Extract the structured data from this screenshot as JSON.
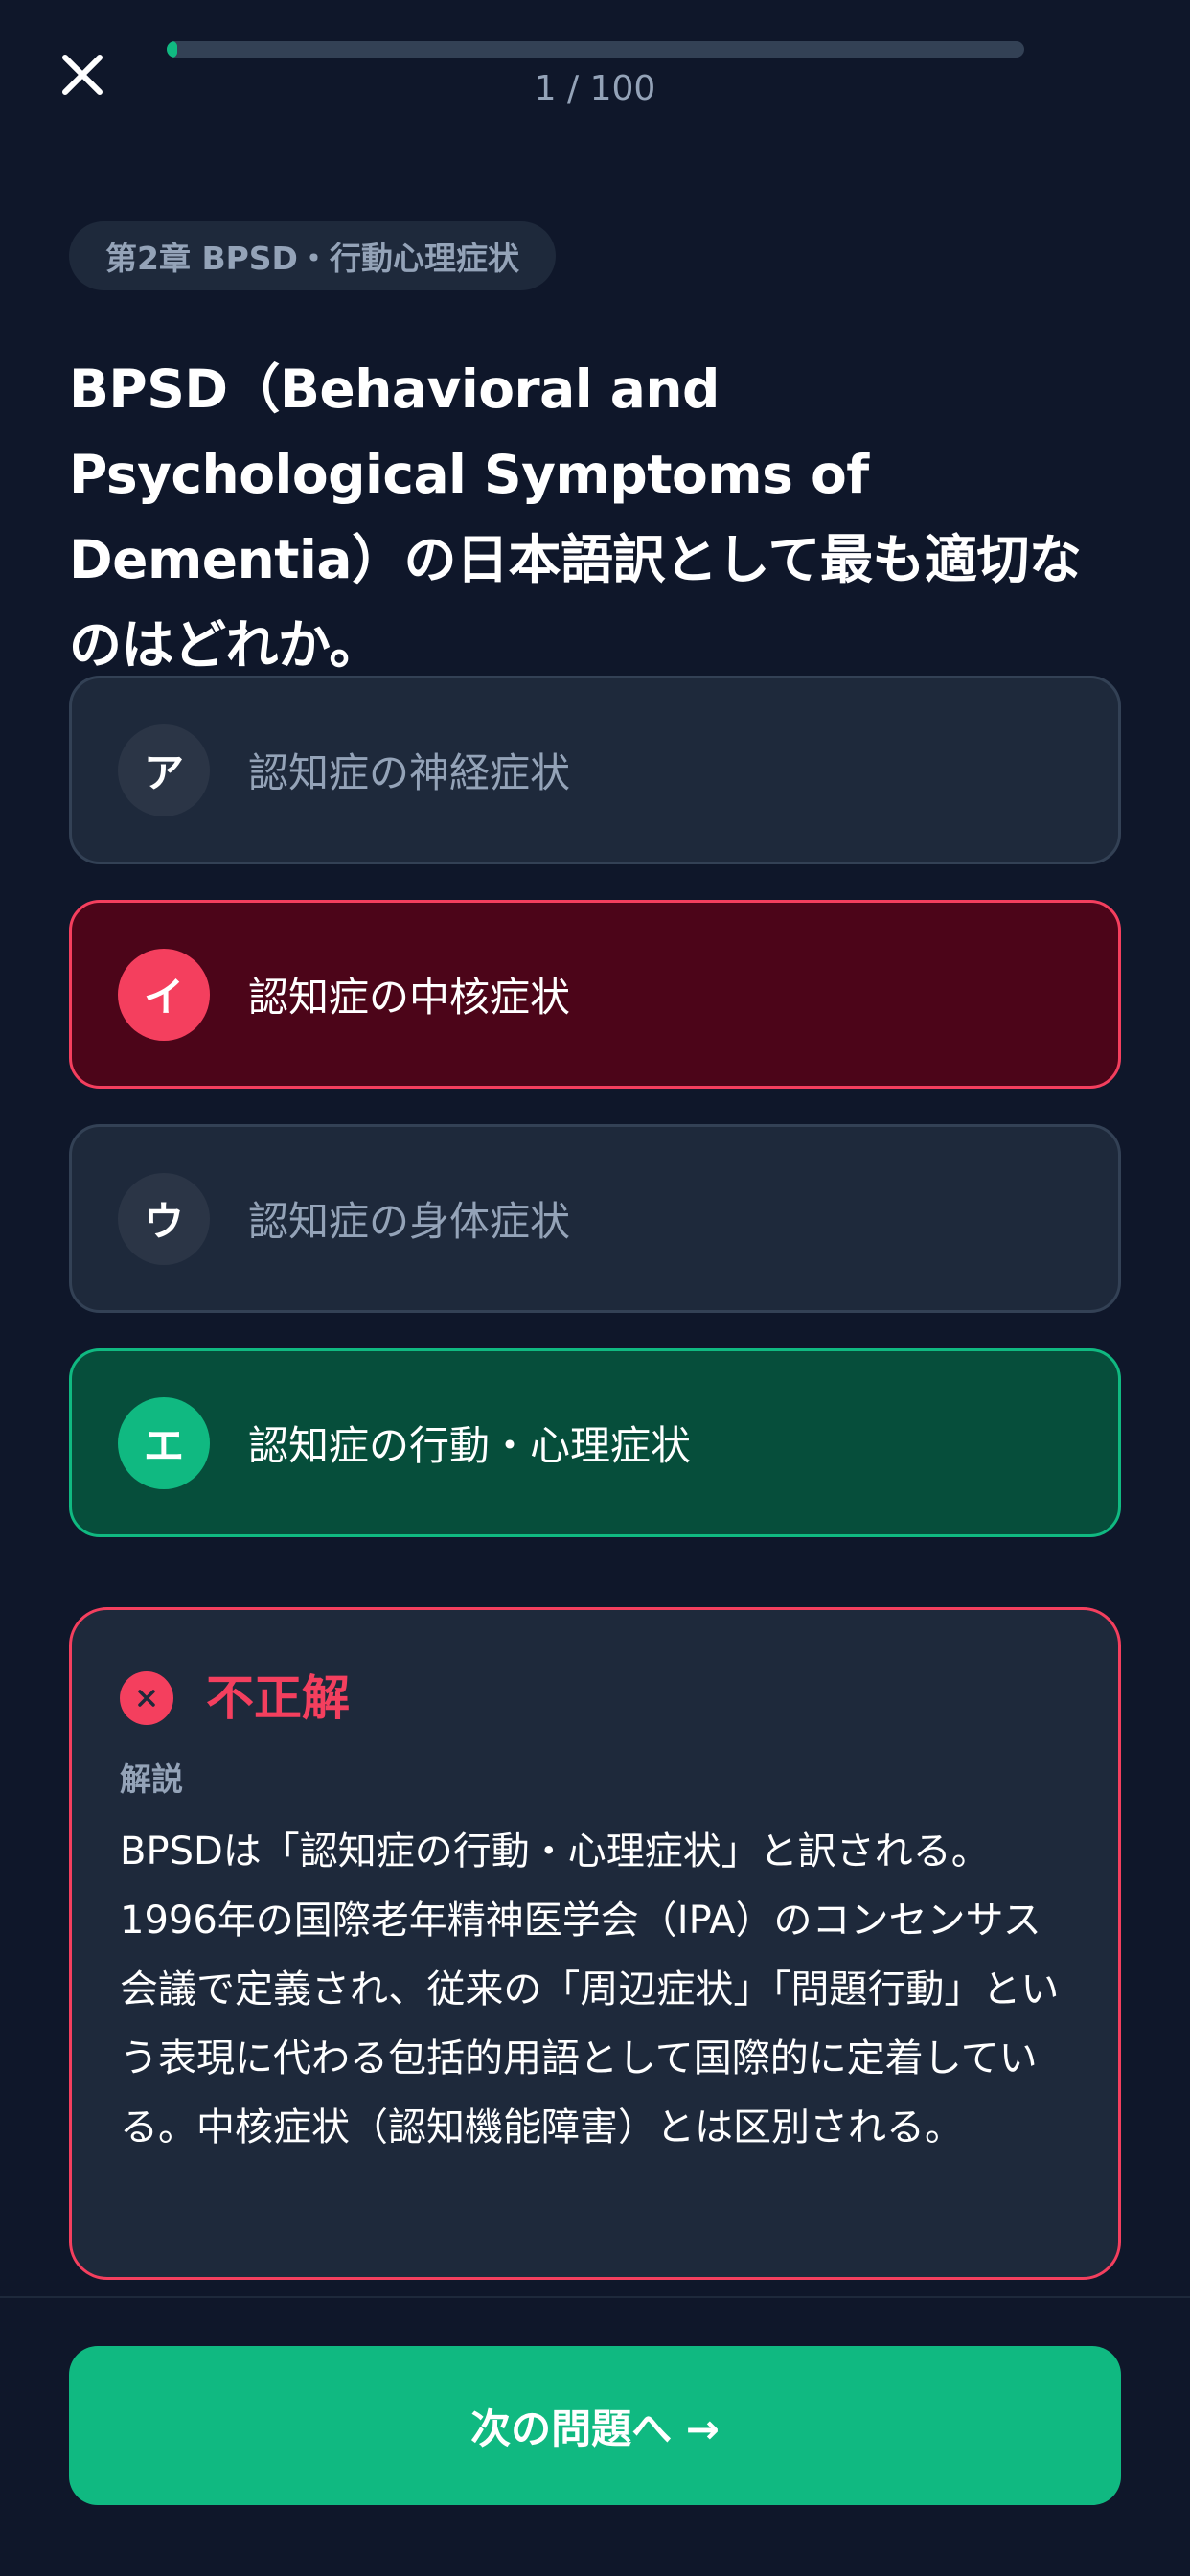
{
  "header": {
    "close_icon": "close-icon",
    "progress_label": "1 / 100",
    "progress_fraction": 0.01,
    "progress_color": "#10b981"
  },
  "chapter": "第2章 BPSD・行動心理症状",
  "question": "BPSD（Behavioral and Psychological Symptoms of Dementia）の日本語訳として最も適切なのはどれか。",
  "options": [
    {
      "letter": "ア",
      "text": "認知症の神経症状",
      "state": "default"
    },
    {
      "letter": "イ",
      "text": "認知症の中核症状",
      "state": "selected-wrong"
    },
    {
      "letter": "ウ",
      "text": "認知症の身体症状",
      "state": "default"
    },
    {
      "letter": "エ",
      "text": "認知症の行動・心理症状",
      "state": "correct"
    }
  ],
  "feedback": {
    "icon": "x-circle-icon",
    "result": "不正解",
    "label": "解説",
    "explanation": "BPSDは「認知症の行動・心理症状」と訳される。1996年の国際老年精神医学会（IPA）のコンセンサス会議で定義され、従来の「周辺症状」「問題行動」という表現に代わる包括的用語として国際的に定着している。中核症状（認知機能障害）とは区別される。"
  },
  "next_button": "次の問題へ →",
  "colors": {
    "background": "#0f172a",
    "card": "#1e293b",
    "correct": "#10b981",
    "wrong": "#f43f5e"
  }
}
